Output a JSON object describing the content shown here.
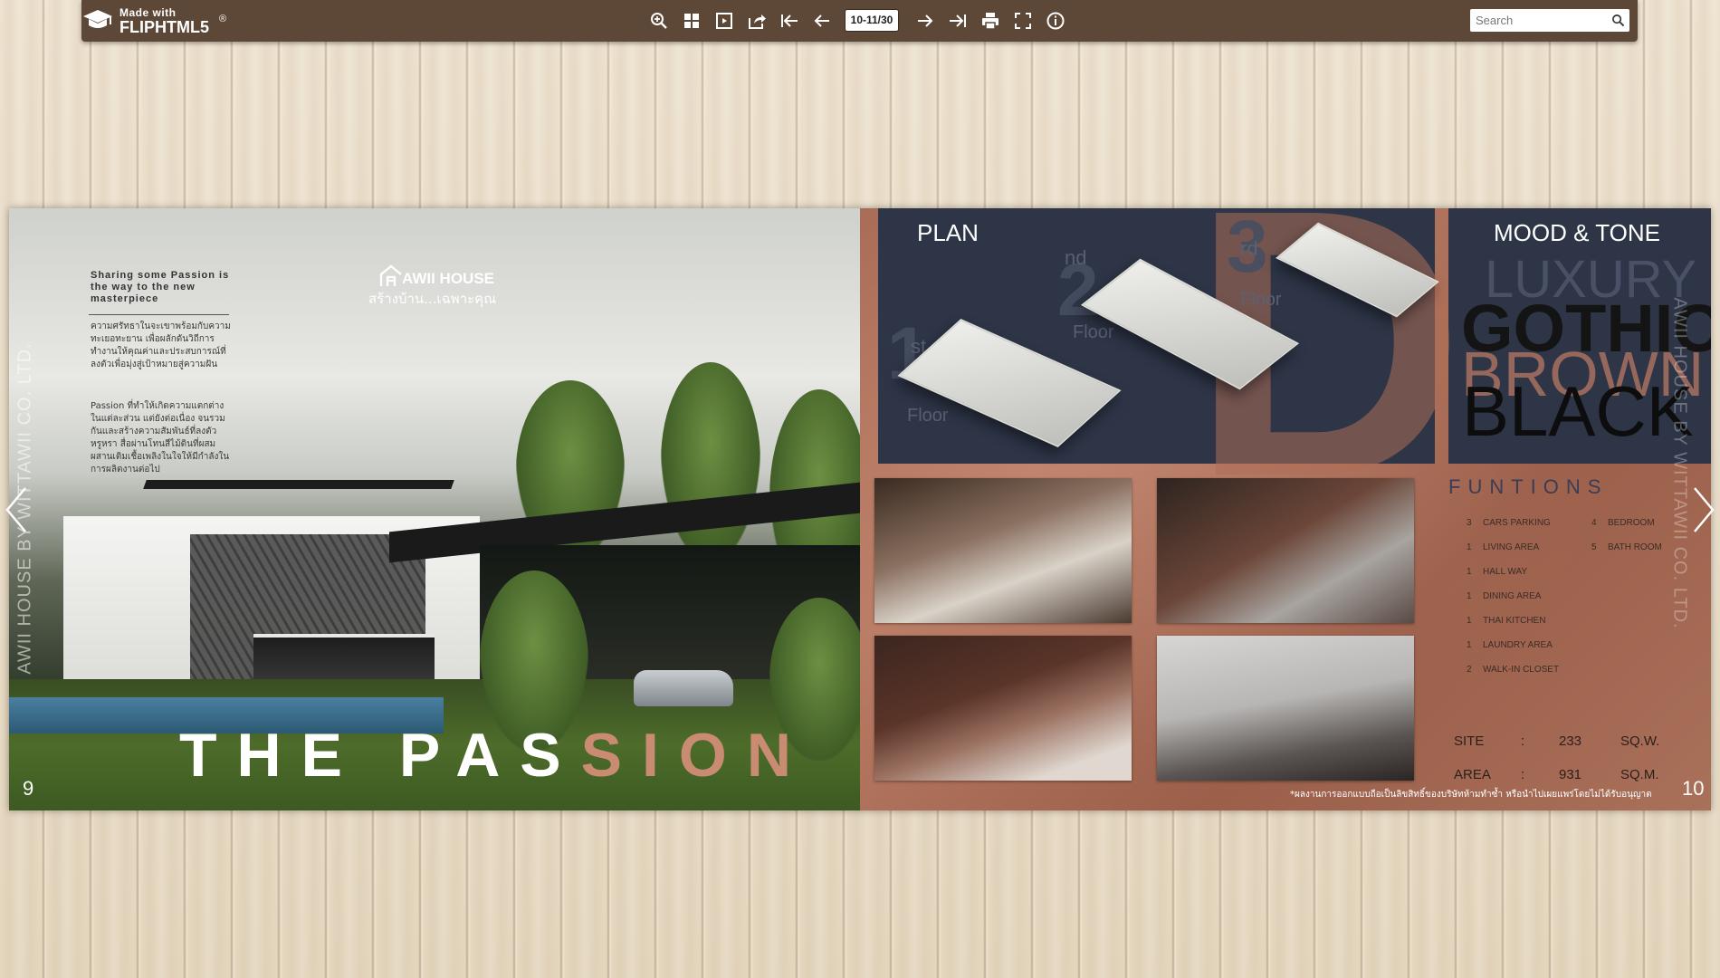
{
  "toolbar": {
    "logo_made": "Made with",
    "logo_brand": "FLIPHTML5",
    "logo_reg": "®",
    "page_indicator": "10-11/30",
    "search_placeholder": "Search",
    "bg_color": "#5d4837"
  },
  "left_page": {
    "vertical_text": "AWII HOUSE BY WITTAWII CO. LTD.",
    "tagline": "Sharing some Passion is the way to the new masterpiece",
    "paragraph_1": "ความศรัทธาในจะเขาพร้อมกับความทะเยอทะยาน เพื่อผลักดันวิถีการทำงานให้คุณค่าและประสบการณ์ที่ลงตัวเพื่อมุ่งสู่เป้าหมายสู่ความฝัน",
    "paragraph_2": "Passion ที่ทำให้เกิดความแตกต่าง ในแต่ละส่วน แต่ยังต่อเนื่อง จนรวมกันและสร้างความสัมพันธ์ที่ลงตัว หรูหรา สื่อผ่านโทนสีไม้ดินที่ผสมผสานเติมเชื้อเพลิงในใจให้มีกำลังในการผลิตงานต่อไป",
    "brand_name": "AWII HOUSE",
    "brand_sub": "สร้างบ้าน...เฉพาะคุณ",
    "title_main": "THE PAS",
    "title_accent": "SION",
    "page_number": "9"
  },
  "right_page": {
    "plan_label": "PLAN",
    "mood_label": "MOOD & TONE",
    "floors": [
      {
        "num": "1",
        "suffix": "st",
        "word": "Floor"
      },
      {
        "num": "2",
        "suffix": "nd",
        "word": "Floor"
      },
      {
        "num": "3",
        "suffix": "rd",
        "word": "Floor"
      }
    ],
    "mood_words": [
      "LUXURY",
      "GOTHIC",
      "BROWN",
      "BLACK"
    ],
    "functions_title": "FUNTIONS",
    "functions_left": [
      {
        "n": "3",
        "label": "CARS PARKING"
      },
      {
        "n": "1",
        "label": "LIVING AREA"
      },
      {
        "n": "1",
        "label": "HALL WAY"
      },
      {
        "n": "1",
        "label": "DINING AREA"
      },
      {
        "n": "1",
        "label": "THAI KITCHEN"
      },
      {
        "n": "1",
        "label": "LAUNDRY AREA"
      },
      {
        "n": "2",
        "label": "WALK-IN CLOSET"
      }
    ],
    "functions_right": [
      {
        "n": "4",
        "label": "BEDROOM"
      },
      {
        "n": "5",
        "label": "BATH ROOM"
      }
    ],
    "site_label": "SITE",
    "site_colon": ":",
    "site_value": "233",
    "site_unit": "SQ.W.",
    "area_label": "AREA",
    "area_colon": ":",
    "area_value": "931",
    "area_unit": "SQ.M.",
    "disclaimer": "*ผลงานการออกแบบถือเป็นลิขสิทธิ์ของบริษัทห้ามทำซ้ำ หรือนำไปเผยแพร่โดยไม่ได้รับอนุญาต",
    "vertical_text": "AWII HOUSE BY WITTAWII CO. LTD.",
    "page_number": "10"
  },
  "icons": [
    "zoom-in-icon",
    "thumbnails-icon",
    "single-page-icon",
    "share-icon",
    "first-page-icon",
    "previous-page-icon",
    "next-page-icon",
    "last-page-icon",
    "print-icon",
    "fullscreen-icon",
    "info-icon",
    "search-icon",
    "prev-spread-arrow-icon",
    "next-spread-arrow-icon"
  ]
}
